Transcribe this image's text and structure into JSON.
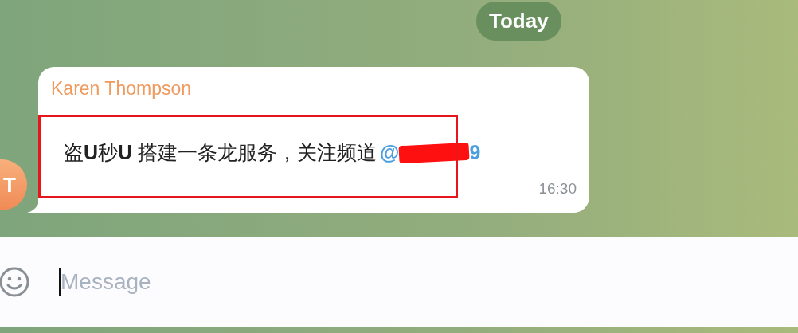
{
  "date_badge": "Today",
  "message": {
    "sender": "Karen Thompson",
    "avatar_initials": "T",
    "text": "盗**U**秒**U** 搭建一条龙服务，关注频道",
    "mention_prefix": "@",
    "mention_suffix": "9",
    "redacted": true,
    "highlighted": true,
    "time": "16:30"
  },
  "composer": {
    "placeholder": "Message"
  }
}
